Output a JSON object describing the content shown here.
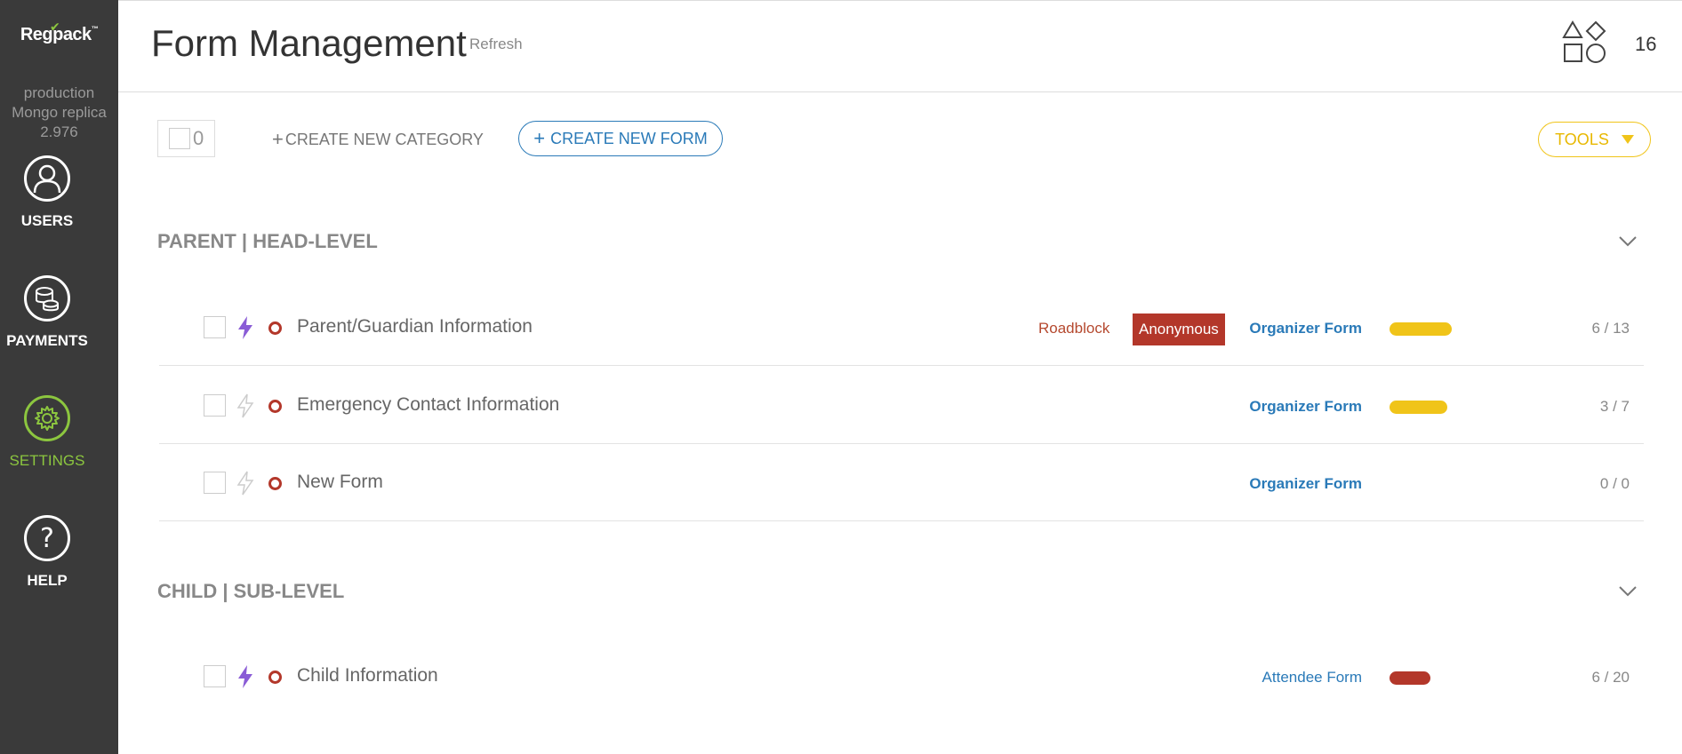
{
  "sidebar": {
    "logo": "Regpack",
    "env_lines": [
      "production",
      "Mongo replica",
      "2.976"
    ],
    "items": [
      {
        "label": "USERS",
        "icon": "user-icon"
      },
      {
        "label": "PAYMENTS",
        "icon": "coins-icon"
      },
      {
        "label": "SETTINGS",
        "icon": "gear-icon",
        "active": true
      },
      {
        "label": "HELP",
        "icon": "question-icon"
      }
    ]
  },
  "header": {
    "title": "Form Management",
    "refresh": "Refresh",
    "count": "16"
  },
  "toolbar": {
    "selected_count": "0",
    "create_category": "CREATE NEW CATEGORY",
    "create_form": "CREATE NEW FORM",
    "tools": "TOOLS"
  },
  "sections": [
    {
      "title": "PARENT | HEAD-LEVEL",
      "forms": [
        {
          "name": "Parent/Guardian Information",
          "roadblock": "Roadblock",
          "anonymous": "Anonymous",
          "type": "Organizer Form",
          "progress_color": "#f0c419",
          "ratio": "6 / 13",
          "active_bolt": true
        },
        {
          "name": "Emergency Contact Information",
          "type": "Organizer Form",
          "progress_color": "#f0c419",
          "ratio": "3 / 7",
          "active_bolt": false
        },
        {
          "name": "New Form",
          "type": "Organizer Form",
          "ratio": "0 / 0",
          "active_bolt": false
        }
      ]
    },
    {
      "title": "CHILD | SUB-LEVEL",
      "forms": [
        {
          "name": "Child Information",
          "type": "Attendee Form",
          "progress_color": "#b3372a",
          "ratio": "6 / 20",
          "active_bolt": true
        }
      ]
    }
  ],
  "colors": {
    "accent_blue": "#2a7ab8",
    "accent_green": "#8cc63f",
    "accent_yellow": "#f0c419",
    "accent_red": "#b3372a",
    "sidebar_bg": "#3a3a3a"
  }
}
